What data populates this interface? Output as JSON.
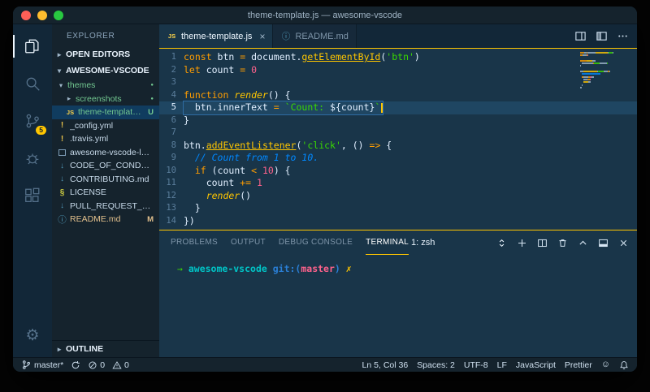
{
  "window": {
    "title": "theme-template.js — awesome-vscode"
  },
  "activity_bar": {
    "badge": "5"
  },
  "icons": {
    "gear": "⚙",
    "chevron_right": "▸",
    "chevron_down": "▾",
    "js": "JS",
    "yaml": "!",
    "md_arrow": "↓",
    "license": "§",
    "info": "ⓘ",
    "dot": "●",
    "close_tab": "×",
    "smiley": "☺"
  },
  "sidebar": {
    "title": "EXPLORER",
    "open_editors": "OPEN EDITORS",
    "workspace": "AWESOME-VSCODE",
    "outline": "OUTLINE",
    "tree": [
      {
        "label": "themes",
        "type": "folder",
        "chevron": "down",
        "indent": 0,
        "color": "#73c991",
        "dot": true
      },
      {
        "label": "screenshots",
        "type": "folder",
        "chevron": "right",
        "indent": 1,
        "color": "#73c991",
        "dot": true
      },
      {
        "label": "theme-template…",
        "type": "js",
        "indent": 1,
        "color": "#73c991",
        "badge": "U",
        "selected": true
      },
      {
        "label": "_config.yml",
        "type": "yml",
        "indent": 0
      },
      {
        "label": ".travis.yml",
        "type": "yml",
        "indent": 0
      },
      {
        "label": "awesome-vscode-logo…",
        "type": "image",
        "indent": 0
      },
      {
        "label": "CODE_OF_CONDUCT.…",
        "type": "md",
        "indent": 0
      },
      {
        "label": "CONTRIBUTING.md",
        "type": "md",
        "indent": 0
      },
      {
        "label": "LICENSE",
        "type": "license",
        "indent": 0
      },
      {
        "label": "PULL_REQUEST_TEMP…",
        "type": "md",
        "indent": 0
      },
      {
        "label": "README.md",
        "type": "info",
        "indent": 0,
        "color": "#e2c08d",
        "badge": "M"
      }
    ]
  },
  "editor_group": {
    "tabs": [
      {
        "label": "theme-template.js",
        "icon": "js",
        "active": true
      },
      {
        "label": "README.md",
        "icon": "info",
        "active": false
      }
    ]
  },
  "editor": {
    "cursor_line": 5,
    "lines": [
      {
        "n": 1,
        "tokens": [
          [
            "kw",
            "const "
          ],
          [
            "tx",
            "btn "
          ],
          [
            "kw",
            "= "
          ],
          [
            "tx",
            "document."
          ],
          [
            "fnu",
            "getElementById"
          ],
          [
            "tx",
            "("
          ],
          [
            "str",
            "'btn'"
          ],
          [
            "tx",
            ")"
          ]
        ]
      },
      {
        "n": 2,
        "tokens": [
          [
            "kw",
            "let "
          ],
          [
            "tx",
            "count "
          ],
          [
            "kw",
            "= "
          ],
          [
            "num",
            "0"
          ]
        ]
      },
      {
        "n": 3,
        "tokens": []
      },
      {
        "n": 4,
        "tokens": [
          [
            "kw",
            "function "
          ],
          [
            "fn",
            "render"
          ],
          [
            "tx",
            "() {"
          ]
        ]
      },
      {
        "n": 5,
        "tokens": [
          [
            "tx",
            "  btn.innerText "
          ],
          [
            "kw",
            "= "
          ],
          [
            "str",
            "`Count: "
          ],
          [
            "tx",
            "${count}"
          ],
          [
            "str",
            "`"
          ]
        ]
      },
      {
        "n": 6,
        "tokens": [
          [
            "tx",
            "}"
          ]
        ]
      },
      {
        "n": 7,
        "tokens": []
      },
      {
        "n": 8,
        "tokens": [
          [
            "tx",
            "btn."
          ],
          [
            "fnu",
            "addEventListener"
          ],
          [
            "tx",
            "("
          ],
          [
            "str",
            "'click'"
          ],
          [
            "tx",
            ", () "
          ],
          [
            "kw",
            "=> "
          ],
          [
            "tx",
            "{"
          ]
        ]
      },
      {
        "n": 9,
        "tokens": [
          [
            "cm",
            "  // Count from 1 to 10."
          ]
        ]
      },
      {
        "n": 10,
        "tokens": [
          [
            "kw",
            "  if "
          ],
          [
            "tx",
            "(count "
          ],
          [
            "kw",
            "< "
          ],
          [
            "num",
            "10"
          ],
          [
            "tx",
            ") {"
          ]
        ]
      },
      {
        "n": 11,
        "tokens": [
          [
            "tx",
            "    count "
          ],
          [
            "kw",
            "+= "
          ],
          [
            "num",
            "1"
          ]
        ]
      },
      {
        "n": 12,
        "tokens": [
          [
            "fn",
            "    render"
          ],
          [
            "tx",
            "()"
          ]
        ]
      },
      {
        "n": 13,
        "tokens": [
          [
            "tx",
            "  }"
          ]
        ]
      },
      {
        "n": 14,
        "tokens": [
          [
            "tx",
            "})"
          ]
        ]
      }
    ]
  },
  "panel": {
    "tabs": [
      {
        "label": "PROBLEMS"
      },
      {
        "label": "OUTPUT"
      },
      {
        "label": "DEBUG CONSOLE"
      },
      {
        "label": "TERMINAL",
        "active": true
      }
    ],
    "dropdown": "1: zsh"
  },
  "terminal": {
    "prompt": [
      [
        "g",
        "→ "
      ],
      [
        "cy",
        "awesome-vscode "
      ],
      [
        "bl",
        "git:("
      ],
      [
        "rd",
        "master"
      ],
      [
        "bl",
        ") "
      ],
      [
        "yl",
        "✗"
      ]
    ]
  },
  "status_bar": {
    "left": [
      {
        "name": "git-branch",
        "icon": "git",
        "label": "master*"
      },
      {
        "name": "sync",
        "icon": "sync"
      },
      {
        "name": "errors",
        "icon": "err",
        "label": "0"
      },
      {
        "name": "warnings",
        "icon": "warn",
        "label": "0"
      }
    ],
    "right": [
      {
        "name": "line-col",
        "label": "Ln 5, Col 36"
      },
      {
        "name": "indentation",
        "label": "Spaces: 2"
      },
      {
        "name": "encoding",
        "label": "UTF-8"
      },
      {
        "name": "eol",
        "label": "LF"
      },
      {
        "name": "language",
        "label": "JavaScript"
      },
      {
        "name": "formatter",
        "label": "Prettier"
      },
      {
        "name": "feedback",
        "icon": "smiley"
      },
      {
        "name": "notifications",
        "icon": "bell"
      }
    ]
  },
  "colors": {
    "accent": "#ffc600",
    "editor_bg": "#193549",
    "sidebar_bg": "#15232d",
    "activity_bg": "#122738",
    "line_highlight": "#1f4662"
  }
}
